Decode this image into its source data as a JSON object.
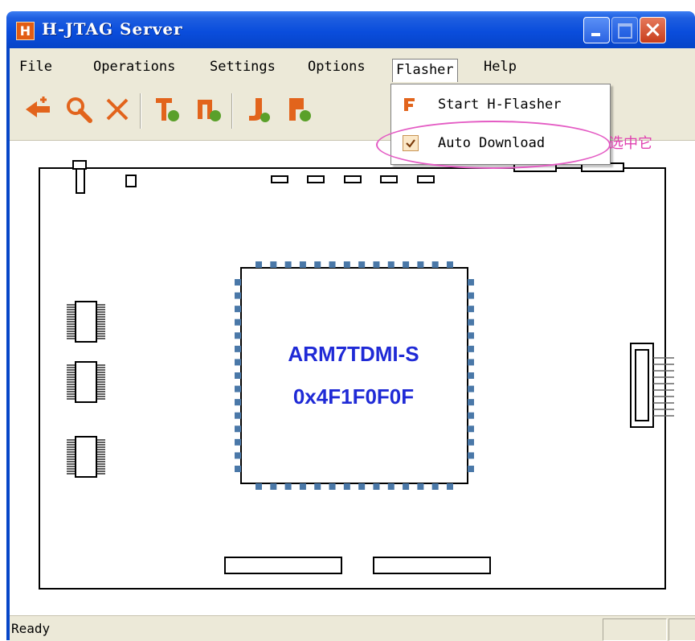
{
  "window": {
    "title": "H-JTAG Server",
    "icon_glyph": "H",
    "controls": [
      "minimize-icon",
      "maximize-icon",
      "close-icon"
    ]
  },
  "menubar": {
    "items": [
      {
        "label": "File"
      },
      {
        "label": "Operations"
      },
      {
        "label": "Settings"
      },
      {
        "label": "Options"
      },
      {
        "label": "Flasher"
      },
      {
        "label": "Help"
      }
    ],
    "active": "Flasher"
  },
  "toolbar": {
    "buttons": [
      "detect-target-icon",
      "search-icon",
      "delete-icon",
      "tdi-icon",
      "tdo-icon",
      "jtag-icon",
      "reset-icon"
    ]
  },
  "flasher_menu": {
    "items": [
      {
        "label": "Start H-Flasher",
        "icon": "flasher-icon"
      },
      {
        "label": "Auto Download",
        "checked": true
      }
    ],
    "note": "选中它"
  },
  "board": {
    "chip_name": "ARM7TDMI-S",
    "chip_id": "0x4F1F0F0F"
  },
  "statusbar": {
    "text": "Ready"
  },
  "colors": {
    "title_bar": "#0a4ddc",
    "chip_text": "#1f2ad6",
    "chip_pins": "#4a78a8",
    "annotation": "#e040b0",
    "menu_background": "#ece9d8"
  }
}
